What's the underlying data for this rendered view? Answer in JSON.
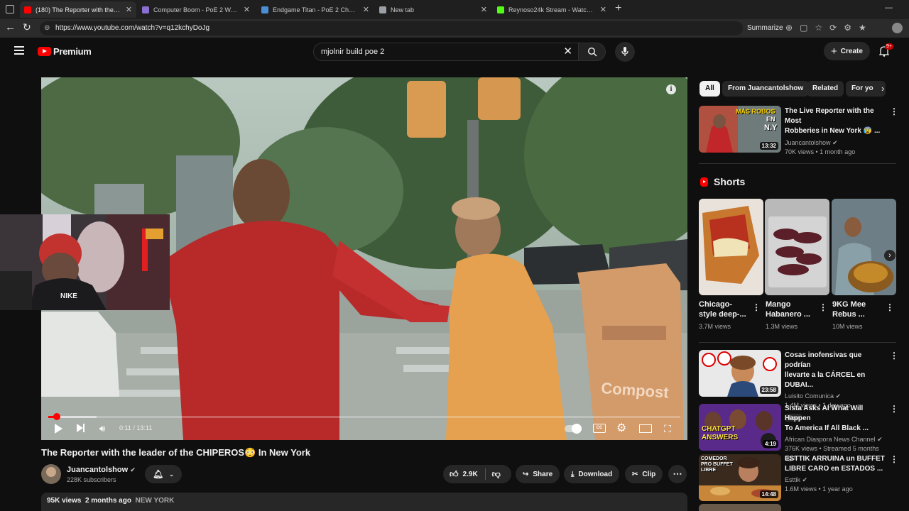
{
  "browser": {
    "tabs": [
      {
        "title": "(180) The Reporter with the leade",
        "color": "#ff0000",
        "active": true
      },
      {
        "title": "Computer Boom - PoE 2 Warrior",
        "color": "#8a6fd1",
        "active": false
      },
      {
        "title": "Endgame Titan - PoE 2 Character",
        "color": "#4a8fd6",
        "active": false
      },
      {
        "title": "New tab",
        "color": "#9aa0a6",
        "active": false
      },
      {
        "title": "Reynoso24k Stream - Watch Live",
        "color": "#53fc18",
        "active": false
      }
    ],
    "url": "https://www.youtube.com/watch?v=q12kchyDoJg",
    "summarize_label": "Summarize"
  },
  "header": {
    "logo_text": "Premium",
    "search_value": "mjolnir build poe 2",
    "create_label": "Create",
    "notif_badge": "9+"
  },
  "player": {
    "time": "0:11 / 13:11",
    "progress_fraction": 0.014,
    "buffer_fraction": 0.076
  },
  "video": {
    "title": "The Reporter with the leader of the CHIPEROS😳 In New York",
    "channel": "Juancantolshow",
    "subscribers": "228K subscribers",
    "likes": "2.9K",
    "share_label": "Share",
    "download_label": "Download",
    "clip_label": "Clip",
    "views": "95K views",
    "date": "2 months ago",
    "location": "NEW YORK"
  },
  "chips": [
    "All",
    "From Juancantolshow",
    "Related",
    "For yo"
  ],
  "top_rec": {
    "title_line1": "The Live Reporter with the Most",
    "title_line2": "Robberies in New York 😰 ...",
    "channel": "Juancantolshow",
    "meta": "70K views • 1 month ago",
    "duration": "13:32",
    "thumb_text_1": "MÁS ROBOS",
    "thumb_text_2": "EN",
    "thumb_text_3": "N.Y"
  },
  "shorts": {
    "heading": "Shorts",
    "items": [
      {
        "title1": "Chicago-",
        "title2": "style deep-...",
        "views": "3.7M views"
      },
      {
        "title1": "Mango",
        "title2": "Habanero ...",
        "views": "1.3M views"
      },
      {
        "title1": "9KG Mee",
        "title2": "Rebus ...",
        "views": "10M views"
      }
    ]
  },
  "recs": [
    {
      "title1": "Cosas inofensivas que podrían",
      "title2": "llevarte a la CÁRCEL en DUBAI...",
      "channel": "Luisito Comunica",
      "meta": "1.4M views • 1 day ago",
      "duration": "23:58",
      "badge": "New"
    },
    {
      "title1": "Sista Asks AI What Will Happen",
      "title2": "To America If All Black ...",
      "channel": "African Diaspora News Channel",
      "meta": "376K views • Streamed 5 months ago",
      "duration": "4:19",
      "thumb_text": "CHATGPT ANSWERS"
    },
    {
      "title1": "ESTTIK ARRUINA un BUFFET",
      "title2": "LIBRE CARO en ESTADOS ...",
      "channel": "Esttik",
      "meta": "1.6M views • 1 year ago",
      "duration": "14:48",
      "thumb_text": "COMEDOR PRO BUFFET LIBRE"
    }
  ],
  "colors": {
    "accent": "#ff0000",
    "bg": "#0f0f0f"
  }
}
